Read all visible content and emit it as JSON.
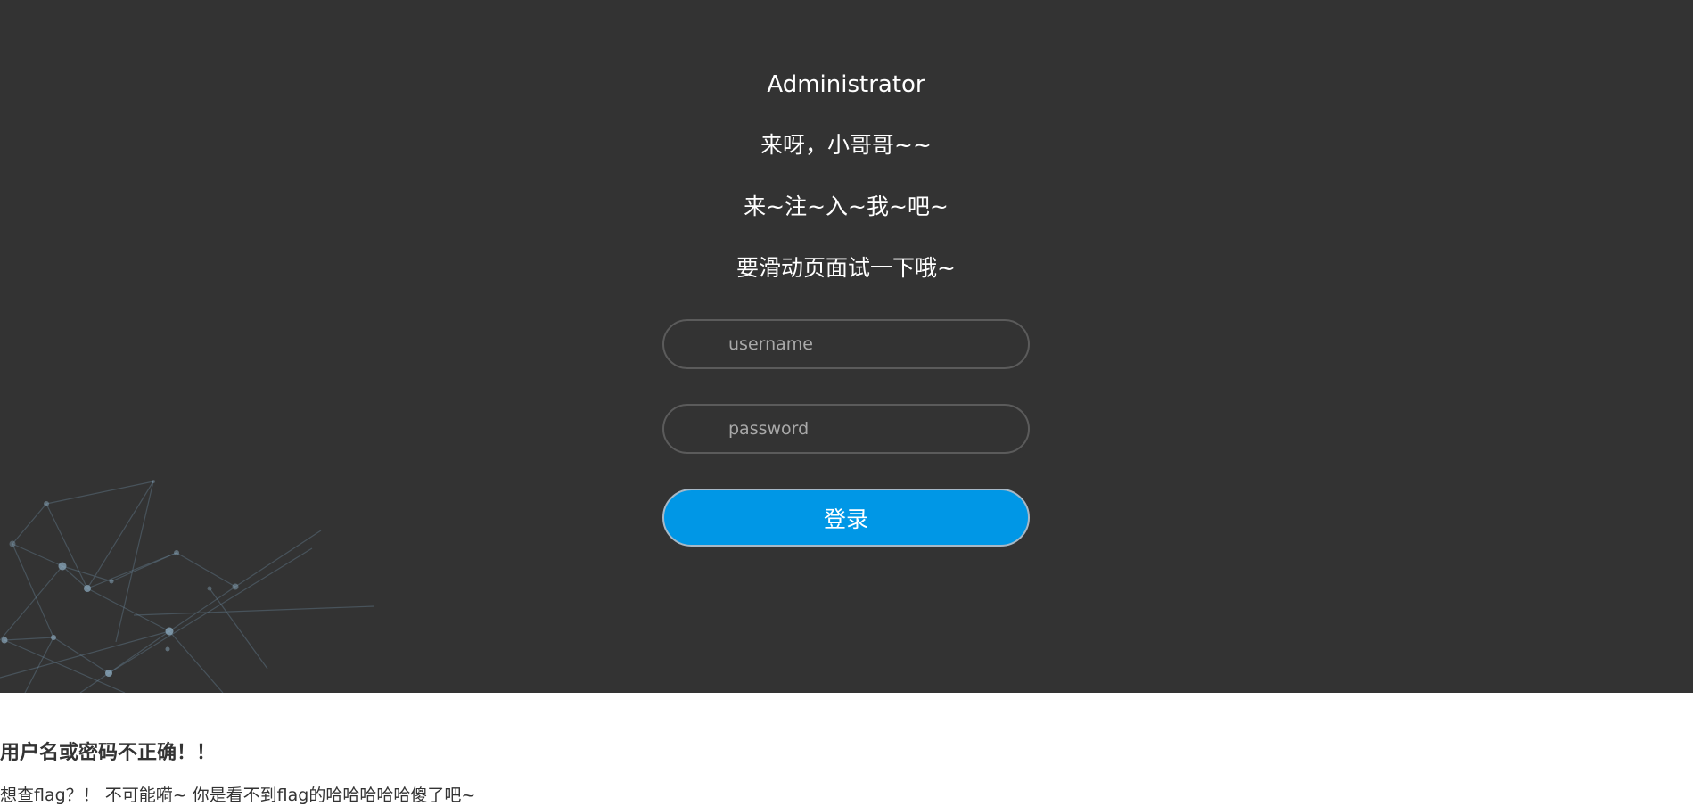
{
  "login": {
    "title": "Administrator",
    "line1": "来呀，小哥哥~~",
    "line2": "来~注~入~我~吧~",
    "line3": "要滑动页面试一下哦~",
    "username_placeholder": "username",
    "password_placeholder": "password",
    "submit_label": "登录"
  },
  "result": {
    "error_message": "用户名或密码不正确！！",
    "flag_message": "想查flag？！ 不可能嗬~ 你是看不到flag的哈哈哈哈哈傻了吧~"
  },
  "colors": {
    "background": "#333333",
    "button": "#0097e6",
    "network_lines": "#6f8fa6"
  }
}
